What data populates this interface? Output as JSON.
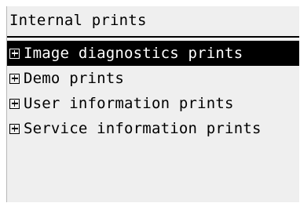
{
  "screen": {
    "title": "Internal prints"
  },
  "menu": {
    "items": [
      {
        "label": "Image diagnostics prints",
        "selected": true,
        "icon": "expand-plus-icon"
      },
      {
        "label": "Demo prints",
        "selected": false,
        "icon": "expand-plus-icon"
      },
      {
        "label": "User information prints",
        "selected": false,
        "icon": "expand-plus-icon"
      },
      {
        "label": "Service information prints",
        "selected": false,
        "icon": "expand-plus-icon"
      }
    ]
  },
  "colors": {
    "background": "#efefef",
    "text": "#000000",
    "selected_background": "#000000",
    "selected_text": "#ffffff"
  }
}
